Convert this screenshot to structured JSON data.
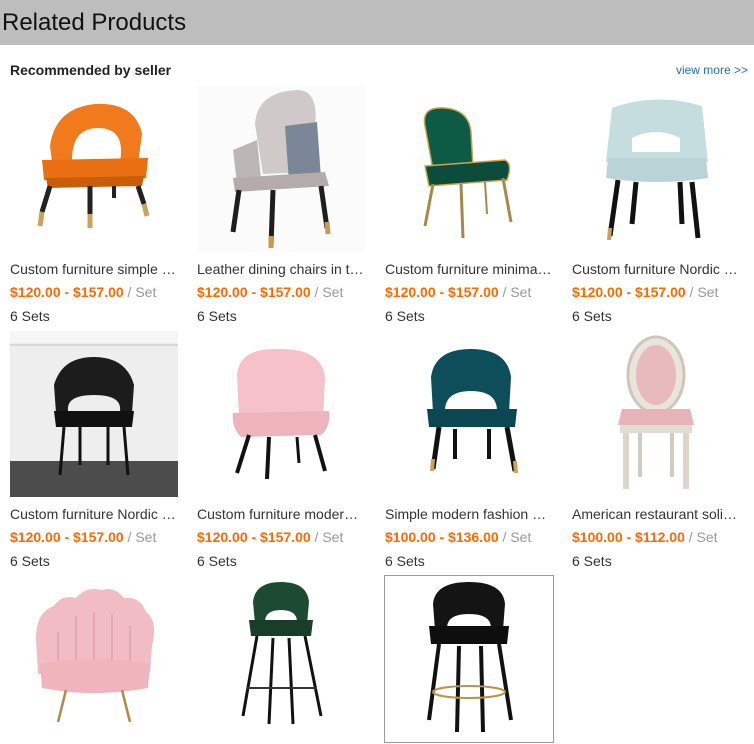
{
  "header": {
    "title": "Related Products"
  },
  "section": {
    "title": "Recommended by seller",
    "view_more": "view more >>"
  },
  "products": [
    {
      "name": "Custom furniture simple modern",
      "price": "$120.00 - $157.00",
      "unit": " / Set",
      "moq": "6 Sets",
      "image": "orange-dining-chair"
    },
    {
      "name": "Leather dining chairs in taupe",
      "price": "$120.00 - $157.00",
      "unit": " / Set",
      "moq": "6 Sets",
      "image": "taupe-leather-chair"
    },
    {
      "name": "Custom furniture minimalist",
      "price": "$120.00 - $157.00",
      "unit": " / Set",
      "moq": "6 Sets",
      "image": "green-velvet-chair"
    },
    {
      "name": "Custom furniture Nordic style",
      "price": "$120.00 - $157.00",
      "unit": " / Set",
      "moq": "6 Sets",
      "image": "light-blue-chair"
    },
    {
      "name": "Custom furniture Nordic style",
      "price": "$120.00 - $157.00",
      "unit": " / Set",
      "moq": "6 Sets",
      "image": "black-chair-room"
    },
    {
      "name": "Custom furniture modern pink",
      "price": "$120.00 - $157.00",
      "unit": " / Set",
      "moq": "6 Sets",
      "image": "pink-tub-chair"
    },
    {
      "name": "Simple modern fashion dining",
      "price": "$100.00 - $136.00",
      "unit": " / Set",
      "moq": "6 Sets",
      "image": "teal-velvet-chair"
    },
    {
      "name": "American restaurant solid wood",
      "price": "$100.00 - $112.00",
      "unit": " / Set",
      "moq": "6 Sets",
      "image": "oval-back-chair"
    },
    {
      "name": "",
      "price": "",
      "unit": "",
      "moq": "",
      "image": "pink-shell-armchair"
    },
    {
      "name": "",
      "price": "",
      "unit": "",
      "moq": "",
      "image": "green-bar-stool"
    },
    {
      "name": "",
      "price": "",
      "unit": "",
      "moq": "",
      "image": "black-bar-stool"
    }
  ]
}
